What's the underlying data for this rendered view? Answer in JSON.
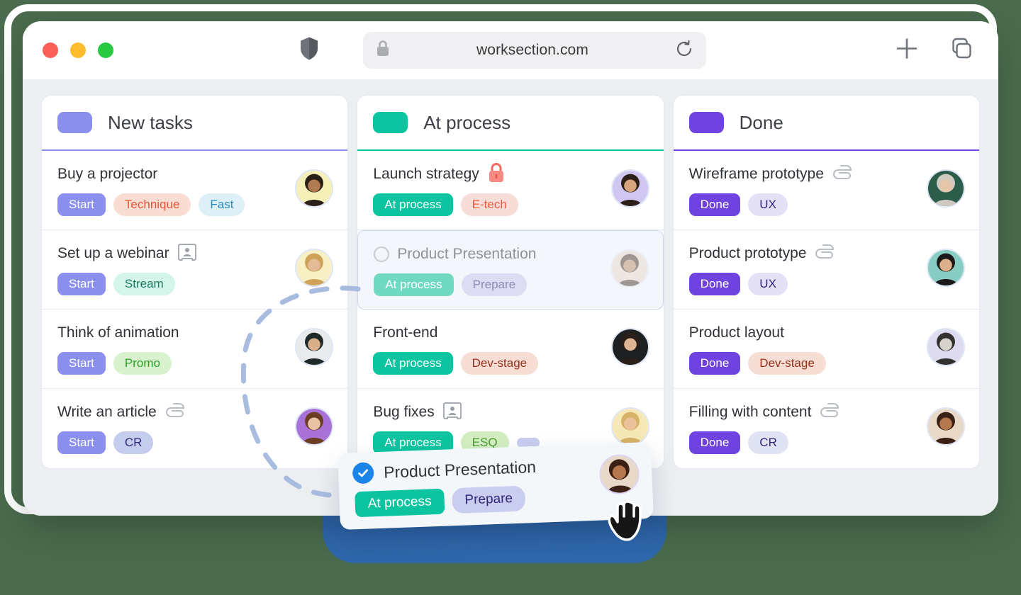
{
  "page": {
    "background_color": "#4a6b4d"
  },
  "browser": {
    "traffic_lights": [
      "close-red",
      "minimize-yellow",
      "zoom-green"
    ],
    "shield_icon": "shield-icon",
    "lock_icon": "lock-icon",
    "url": "worksection.com",
    "reload_icon": "reload-icon",
    "new_tab_icon": "plus-icon",
    "tab_overview_icon": "copy-tabs-icon"
  },
  "board": {
    "columns": [
      {
        "id": "new-tasks",
        "title": "New tasks",
        "accent": "#8b90ec",
        "tasks": [
          {
            "title": "Buy a projector",
            "icon": "",
            "tags": [
              {
                "label": "Start",
                "bg": "#8b90ec",
                "fg": "#ffffff",
                "shape": "rect"
              },
              {
                "label": "Technique",
                "bg": "#f9ddd2",
                "fg": "#e8553a",
                "shape": "pill"
              },
              {
                "label": "Fast",
                "bg": "#def0f7",
                "fg": "#2a8cbb",
                "shape": "pill"
              }
            ],
            "avatar": {
              "bg": "#f5efb8",
              "skin": "#b07a52",
              "hair": "#2b2017"
            }
          },
          {
            "title": "Set up a webinar",
            "icon": "contact-card-icon",
            "tags": [
              {
                "label": "Start",
                "bg": "#8b90ec",
                "fg": "#ffffff",
                "shape": "rect"
              },
              {
                "label": "Stream",
                "bg": "#d4f5e9",
                "fg": "#1b7a63",
                "shape": "pill"
              }
            ],
            "avatar": {
              "bg": "#f7f0c4",
              "skin": "#e4bb96",
              "hair": "#cfa259"
            }
          },
          {
            "title": "Think of animation",
            "icon": "",
            "tags": [
              {
                "label": "Start",
                "bg": "#8b90ec",
                "fg": "#ffffff",
                "shape": "rect"
              },
              {
                "label": "Promo",
                "bg": "#d7f2cd",
                "fg": "#2f9e28",
                "shape": "pill"
              }
            ],
            "avatar": {
              "bg": "#e9eaec",
              "skin": "#d8ae8b",
              "hair": "#1d2a28"
            }
          },
          {
            "title": "Write an article",
            "icon": "paperclip-icon",
            "tags": [
              {
                "label": "Start",
                "bg": "#8b90ec",
                "fg": "#ffffff",
                "shape": "rect"
              },
              {
                "label": "CR",
                "bg": "#c5cdef",
                "fg": "#32267c",
                "shape": "pill"
              }
            ],
            "avatar": {
              "bg": "#a872d8",
              "skin": "#e8c3a6",
              "hair": "#6b3d22"
            }
          }
        ]
      },
      {
        "id": "at-process",
        "title": "At process",
        "accent": "#0cc5a0",
        "tasks": [
          {
            "title": "Launch strategy",
            "icon": "lock-red-icon",
            "tags": [
              {
                "label": "At process",
                "bg": "#0cc5a0",
                "fg": "#ffffff",
                "shape": "rect"
              },
              {
                "label": "E-tech",
                "bg": "#f8dcd8",
                "fg": "#ef5a3c",
                "shape": "pill"
              }
            ],
            "avatar": {
              "bg": "#cfc6f2",
              "skin": "#d9a57e",
              "hair": "#2d2019"
            }
          },
          {
            "title": "Product Presentation",
            "icon": "",
            "ghost": true,
            "tags": [
              {
                "label": "At process",
                "bg": "#6fd9c2",
                "fg": "#ffffff",
                "shape": "rect"
              },
              {
                "label": "Prepare",
                "bg": "#dcdcf3",
                "fg": "#8e8bb5",
                "shape": "pill"
              }
            ],
            "avatar": {
              "bg": "#e4d7c7",
              "skin": "#b47f55",
              "hair": "#3a2317"
            }
          },
          {
            "title": "Front-end",
            "icon": "",
            "tags": [
              {
                "label": "At process",
                "bg": "#0cc5a0",
                "fg": "#ffffff",
                "shape": "rect"
              },
              {
                "label": "Dev-stage",
                "bg": "#f7ded4",
                "fg": "#97301c",
                "shape": "pill"
              }
            ],
            "avatar": {
              "bg": "#1e2022",
              "skin": "#e0b594",
              "hair": "#2a1f19"
            }
          },
          {
            "title": "Bug fixes",
            "icon": "contact-card-icon",
            "tags": [
              {
                "label": "At process",
                "bg": "#0cc5a0",
                "fg": "#ffffff",
                "shape": "rect"
              },
              {
                "label": "ESQ",
                "bg": "#d2eec1",
                "fg": "#4e9a33",
                "shape": "pill"
              },
              {
                "label": "",
                "bg": "#c9cdf0",
                "fg": "#32267c",
                "shape": "pill"
              }
            ],
            "avatar": {
              "bg": "#f6e9b7",
              "skin": "#ebc29c",
              "hair": "#d8b267"
            }
          }
        ]
      },
      {
        "id": "done",
        "title": "Done",
        "accent": "#6f43e0",
        "tasks": [
          {
            "title": "Wireframe prototype",
            "icon": "paperclip-icon",
            "tags": [
              {
                "label": "Done",
                "bg": "#6f43e0",
                "fg": "#ffffff",
                "shape": "rect"
              },
              {
                "label": "UX",
                "bg": "#e4e1f7",
                "fg": "#32267c",
                "shape": "pill"
              }
            ],
            "avatar": {
              "bg": "#2c5c4a",
              "skin": "#e6c6a8",
              "hair": "#cfcac0"
            }
          },
          {
            "title": "Product prototype",
            "icon": "paperclip-icon",
            "tags": [
              {
                "label": "Done",
                "bg": "#6f43e0",
                "fg": "#ffffff",
                "shape": "rect"
              },
              {
                "label": "UX",
                "bg": "#e4e1f7",
                "fg": "#32267c",
                "shape": "pill"
              }
            ],
            "avatar": {
              "bg": "#87cdc3",
              "skin": "#dcb08a",
              "hair": "#1c1a18"
            }
          },
          {
            "title": "Product layout",
            "icon": "",
            "tags": [
              {
                "label": "Done",
                "bg": "#6f43e0",
                "fg": "#ffffff",
                "shape": "rect"
              },
              {
                "label": "Dev-stage",
                "bg": "#f7ded4",
                "fg": "#97301c",
                "shape": "pill"
              }
            ],
            "avatar": {
              "bg": "#dedbf0",
              "skin": "#d8d2cc",
              "hair": "#333030"
            }
          },
          {
            "title": "Filling with content",
            "icon": "paperclip-icon",
            "tags": [
              {
                "label": "Done",
                "bg": "#6f43e0",
                "fg": "#ffffff",
                "shape": "rect"
              },
              {
                "label": "CR",
                "bg": "#dfe3f3",
                "fg": "#32267c",
                "shape": "pill"
              }
            ],
            "avatar": {
              "bg": "#e7d8c7",
              "skin": "#b5784c",
              "hair": "#3a2015"
            }
          }
        ]
      }
    ]
  },
  "drag_card": {
    "check_icon": "check-circle-icon",
    "title": "Product Presentation",
    "tags": [
      {
        "label": "At process",
        "bg": "#0cc5a0",
        "fg": "#ffffff",
        "shape": "rect"
      },
      {
        "label": "Prepare",
        "bg": "#c9cdf0",
        "fg": "#32267c",
        "shape": "pill"
      }
    ],
    "cursor_icon": "grab-hand-cursor"
  }
}
